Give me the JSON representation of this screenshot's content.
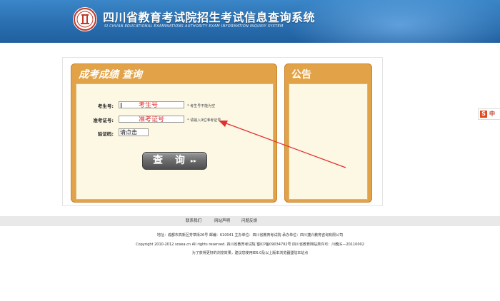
{
  "header": {
    "title": "四川省教育考试院招生考试信息查询系统",
    "subtitle": "SI CHUAN EDUCATIONAL EXAMINATIONS AUTHORITY EXAM INFORMATION INQUIRY SYSTEM",
    "brand_color": "#2a6fb0"
  },
  "query_panel": {
    "title": "成考成绩  查询",
    "fields": {
      "candidate_no_label": "考生号:",
      "candidate_no_placeholder": "考生号",
      "candidate_no_hint": "* 考生号不能为空",
      "admission_no_label": "准考证号:",
      "admission_no_placeholder": "准考证号",
      "admission_no_hint": "* 请输入9位准考证号",
      "captcha_label": "验证码:",
      "captcha_value": "请点击"
    },
    "submit_label": "查 询",
    "submit_arrow": "▸▸"
  },
  "notice_panel": {
    "title": "公告"
  },
  "side_badge": {
    "icon": "S",
    "text": "中"
  },
  "footer": {
    "nav": [
      "联系我们",
      "网站声明",
      "问题反馈"
    ],
    "address_line": "地址：成都市高新区芳草街26号  邮编：610041    主办单位：四川省教育考试院  承办单位：四川捷兴教育咨询有限公司",
    "copyright_line": "Copyright 2010-2012 sceea.cn All rights reserved. 四川省教育考试院        蜀ICP备09034792号  四川省教育网站类许可：川教JG—20110002",
    "browser_note": "为了获得更好的浏览效果，建议您使用IE6.0及以上版本浏览器登陆本站点"
  },
  "colors": {
    "panel_orange": "#e2a348",
    "panel_inner": "#fdf8e4",
    "annotation_red": "#e03030"
  }
}
